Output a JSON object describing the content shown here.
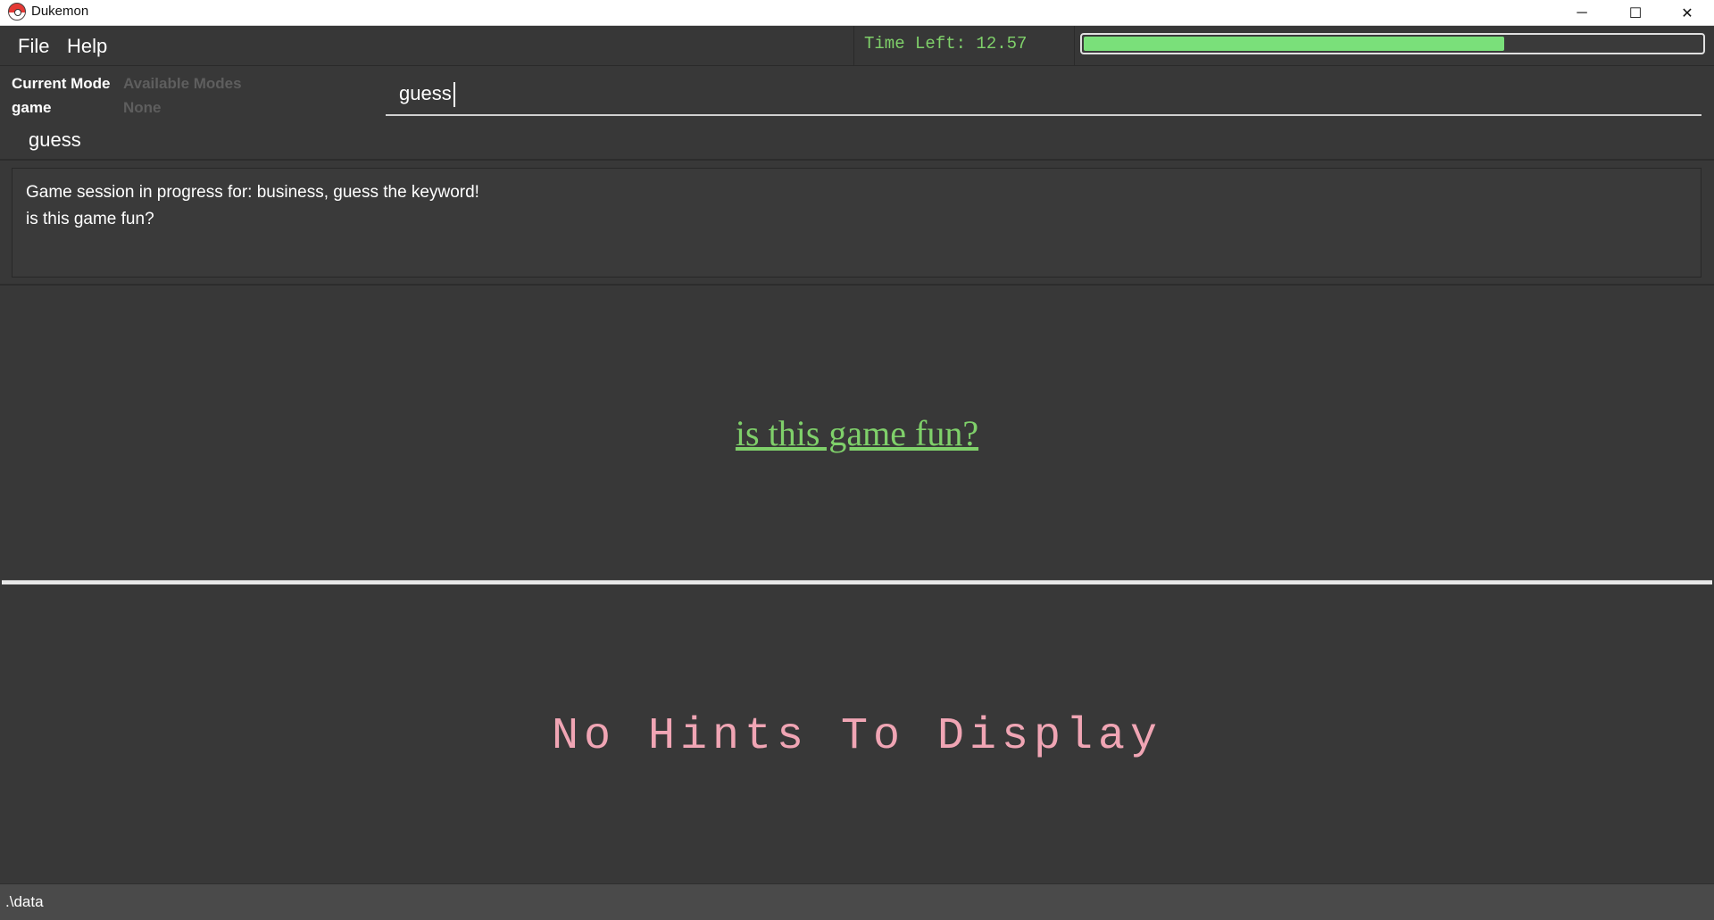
{
  "window": {
    "title": "Dukemon",
    "minimize_glyph": "─",
    "maximize_glyph": "☐",
    "close_glyph": "✕"
  },
  "menu": {
    "file": "File",
    "help": "Help"
  },
  "timer": {
    "label": "Time Left: 12.57",
    "progress_fraction": 0.68,
    "bar_color": "#7ae07a",
    "text_color": "#7fd06a"
  },
  "modes": {
    "current_label": "Current Mode",
    "current_value": "game",
    "available_label": "Available Modes",
    "available_value": "None",
    "sub_mode": "guess"
  },
  "command": {
    "value": "guess"
  },
  "result": {
    "line1": "Game session in progress for: business, guess the keyword!",
    "line2": "is this game fun?"
  },
  "question": {
    "text": "is this game fun?",
    "color": "#7fd06a"
  },
  "hints": {
    "text": "No Hints To Display",
    "color": "#f0a5b4"
  },
  "status": {
    "path": ".\\data"
  }
}
